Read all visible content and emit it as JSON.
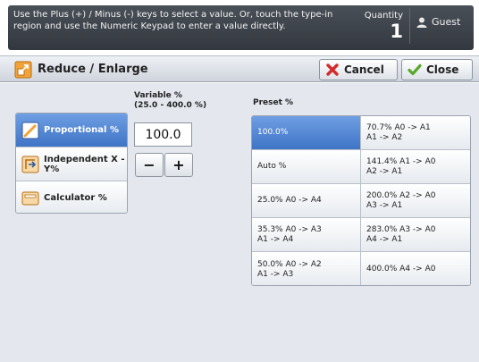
{
  "header": {
    "message": "Use the Plus (+) / Minus (-) keys to select a value.  Or, touch the type-in region and use the Numeric Keypad to enter a value directly.",
    "quantity_label": "Quantity",
    "quantity_value": "1",
    "user_label": "Guest"
  },
  "titlebar": {
    "title": "Reduce / Enlarge",
    "cancel_label": "Cancel",
    "close_label": "Close"
  },
  "modes": [
    {
      "label": "Proportional %",
      "icon": "proportional-icon",
      "selected": true
    },
    {
      "label": "Independent X - Y%",
      "icon": "independent-xy-icon",
      "selected": false
    },
    {
      "label": "Calculator %",
      "icon": "calculator-icon",
      "selected": false
    }
  ],
  "variable": {
    "label": "Variable %",
    "range": "(25.0 - 400.0 %)",
    "value": "100.0",
    "minus_label": "−",
    "plus_label": "+"
  },
  "preset": {
    "label": "Preset %",
    "items": [
      {
        "line1": "100.0%",
        "line2": "",
        "selected": true
      },
      {
        "line1": "70.7% A0 -> A1",
        "line2": "A1 -> A2",
        "selected": false
      },
      {
        "line1": "Auto %",
        "line2": "",
        "selected": false
      },
      {
        "line1": "141.4% A1 -> A0",
        "line2": "A2 -> A1",
        "selected": false
      },
      {
        "line1": "25.0% A0 -> A4",
        "line2": "",
        "selected": false
      },
      {
        "line1": "200.0% A2 -> A0",
        "line2": "A3 -> A1",
        "selected": false
      },
      {
        "line1": "35.3% A0 -> A3",
        "line2": "A1 -> A4",
        "selected": false
      },
      {
        "line1": "283.0% A3 -> A0",
        "line2": "A4 -> A1",
        "selected": false
      },
      {
        "line1": "50.0% A0 -> A2",
        "line2": "A1 -> A3",
        "selected": false
      },
      {
        "line1": "400.0% A4 -> A0",
        "line2": "",
        "selected": false
      }
    ]
  },
  "colors": {
    "selected_blue": "#3f74c6",
    "cancel_red": "#d42b2b",
    "close_green": "#5aa82a"
  }
}
